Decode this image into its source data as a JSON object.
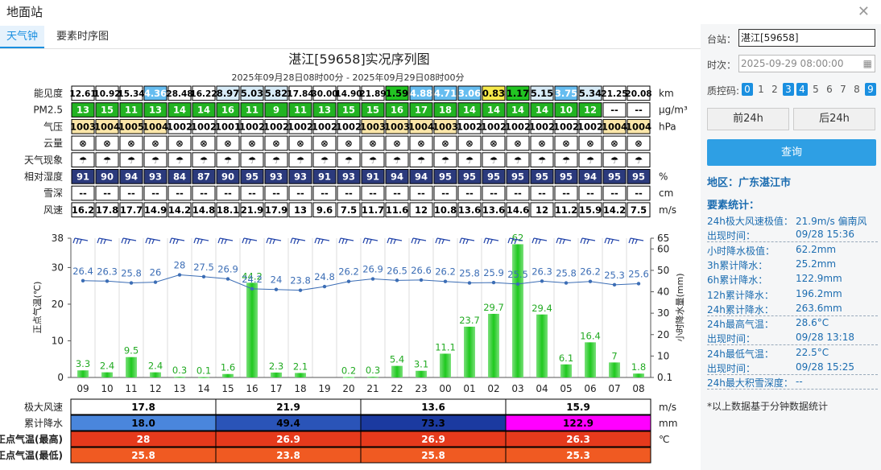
{
  "window": {
    "title": "地面站"
  },
  "tabs": [
    {
      "label": "天气钟"
    },
    {
      "label": "要素时序图"
    }
  ],
  "chart_data": {
    "type": "bar",
    "title": "湛江[59658]实况序列图",
    "subtitle": "2025年09月28日08时00分 - 2025年09月29日08时00分",
    "hours": [
      "09",
      "10",
      "11",
      "12",
      "13",
      "14",
      "15",
      "16",
      "17",
      "18",
      "19",
      "20",
      "21",
      "22",
      "23",
      "00",
      "01",
      "02",
      "03",
      "04",
      "05",
      "06",
      "07",
      "08"
    ],
    "table": {
      "rows": [
        {
          "label": "能见度",
          "unit": "km",
          "values": [
            "12.61",
            "10.92",
            "15.34",
            "4.36",
            "28.48",
            "16.22",
            "8.97",
            "5.03",
            "5.82",
            "17.84",
            "30.00",
            "14.90",
            "21.89",
            "1.59",
            "4.88",
            "4.71",
            "3.06",
            "0.83",
            "1.17",
            "5.15",
            "3.75",
            "5.34",
            "21.25",
            "20.08"
          ],
          "colors": [
            "#ffffff",
            "#ffffff",
            "#ffffff",
            "#66bdf0",
            "#ffffff",
            "#ffffff",
            "#d8ecf8",
            "#d8ecf8",
            "#d8ecf8",
            "#ffffff",
            "#ffffff",
            "#ffffff",
            "#ffffff",
            "#22c422",
            "#66bdf0",
            "#66bdf0",
            "#66bdf0",
            "#f6e94a",
            "#22c422",
            "#d8ecf8",
            "#66bdf0",
            "#d8ecf8",
            "#ffffff",
            "#ffffff"
          ]
        },
        {
          "label": "PM2.5",
          "unit": "μg/m³",
          "values": [
            "13",
            "15",
            "11",
            "13",
            "14",
            "14",
            "16",
            "11",
            "9",
            "11",
            "13",
            "15",
            "15",
            "16",
            "17",
            "18",
            "14",
            "14",
            "14",
            "14",
            "10",
            "12",
            "--",
            "--"
          ],
          "fill": "#22b322"
        },
        {
          "label": "气压",
          "unit": "hPa",
          "values": [
            "1003",
            "1004",
            "1005",
            "1004",
            "1002",
            "1002",
            "1001",
            "1002",
            "1002",
            "1002",
            "1002",
            "1002",
            "1003",
            "1003",
            "1004",
            "1003",
            "1002",
            "1002",
            "1002",
            "1002",
            "1002",
            "1002",
            "1004",
            "1004"
          ],
          "colors": [
            "#fbe6a8",
            "#fbe6a8",
            "#fbe6a8",
            "#fbe6a8",
            "#ffffff",
            "#ffffff",
            "#ffffff",
            "#ffffff",
            "#ffffff",
            "#ffffff",
            "#ffffff",
            "#ffffff",
            "#fbe6a8",
            "#fbe6a8",
            "#fbe6a8",
            "#fbe6a8",
            "#ffffff",
            "#ffffff",
            "#ffffff",
            "#ffffff",
            "#ffffff",
            "#ffffff",
            "#fbe6a8",
            "#fbe6a8"
          ]
        },
        {
          "label": "云量",
          "unit": "",
          "values": [
            "⊗",
            "⊗",
            "⊗",
            "⊗",
            "⊗",
            "⊗",
            "⊗",
            "⊗",
            "⊗",
            "⊗",
            "⊗",
            "⊗",
            "⊗",
            "⊗",
            "⊗",
            "⊗",
            "⊗",
            "⊗",
            "⊗",
            "⊗",
            "⊗",
            "⊗",
            "⊗",
            "⊗"
          ]
        },
        {
          "label": "天气现象",
          "unit": "",
          "values": [
            "☂",
            "☂",
            "☂",
            "☂",
            "☂",
            "☂",
            "☂",
            "☂",
            "☂",
            "☂",
            "☂",
            "☂",
            "☂",
            "☂",
            "☂",
            "☂",
            "☂",
            "☂",
            "☂",
            "☂",
            "☂",
            "☂",
            "☂",
            "☂"
          ]
        },
        {
          "label": "相对湿度",
          "unit": "%",
          "values": [
            "91",
            "90",
            "94",
            "93",
            "84",
            "87",
            "90",
            "95",
            "93",
            "93",
            "91",
            "93",
            "91",
            "94",
            "94",
            "95",
            "95",
            "95",
            "95",
            "95",
            "95",
            "94",
            "95",
            "95"
          ],
          "fill": "#2b3a7c"
        },
        {
          "label": "雪深",
          "unit": "cm",
          "values": [
            "--",
            "--",
            "--",
            "--",
            "--",
            "--",
            "--",
            "--",
            "--",
            "--",
            "--",
            "--",
            "--",
            "--",
            "--",
            "--",
            "--",
            "--",
            "--",
            "--",
            "--",
            "--",
            "--",
            "--"
          ]
        },
        {
          "label": "风速",
          "unit": "m/s",
          "values": [
            "16.2",
            "17.8",
            "17.7",
            "14.9",
            "14.2",
            "14.8",
            "18.1",
            "21.9",
            "17.9",
            "13",
            "9.6",
            "7.5",
            "11.7",
            "11.6",
            "12",
            "10.8",
            "13.6",
            "13.6",
            "14.6",
            "12",
            "11.2",
            "15.9",
            "14.2",
            "7.5"
          ]
        }
      ]
    },
    "temperature": [
      26.4,
      26.3,
      25.8,
      26,
      28,
      27.5,
      26.9,
      24.2,
      24,
      23.8,
      24.8,
      26.2,
      26.9,
      26.5,
      26.6,
      26.2,
      25.8,
      25.9,
      25.5,
      26.3,
      25.8,
      26.2,
      25.3,
      25.6
    ],
    "precip": [
      3.3,
      2.4,
      9.5,
      2.4,
      0.3,
      0.1,
      1.6,
      44.2,
      2.3,
      2.1,
      0,
      0.2,
      0.3,
      5.4,
      3.1,
      11.1,
      23.7,
      29.7,
      62.2,
      29.4,
      6.1,
      16.4,
      7,
      1.8
    ],
    "precip_labels": [
      "3.3",
      "2.4",
      "9.5",
      "2.4",
      "0.3",
      "0.1",
      "1.6",
      "44.2",
      "2.3",
      "2.1",
      "",
      "0.2",
      "0.3",
      "5.4",
      "3.1",
      "11.1",
      "23.7",
      "29.7",
      "62",
      "29.4",
      "6.1",
      "16.4",
      "7",
      "1.8"
    ],
    "ylabel_left": "正点气温(℃)",
    "ylabel_right": "小时降水量(mm)",
    "yleft_ticks": [
      "0",
      "10",
      "20",
      "30",
      "38"
    ],
    "yright_ticks": [
      "0.1",
      "10",
      "20",
      "30",
      "40",
      "50",
      "60",
      "65"
    ],
    "ylim_left": [
      0,
      38
    ],
    "ylim_right": [
      0,
      65
    ],
    "summary": [
      {
        "label": "极大风速",
        "unit": "m/s",
        "values": [
          "17.8",
          "21.9",
          "13.6",
          "15.9"
        ],
        "colors": [
          "#ffffff",
          "#ffffff",
          "#ffffff",
          "#ffffff"
        ],
        "text": "#000"
      },
      {
        "label": "累计降水",
        "unit": "mm",
        "values": [
          "18.0",
          "49.4",
          "73.3",
          "122.9"
        ],
        "colors": [
          "#4a86dc",
          "#2a54b8",
          "#1b3aa0",
          "#ff00ff"
        ],
        "text": "#000"
      },
      {
        "label": "正点气温(最高)",
        "unit": "℃",
        "values": [
          "28",
          "26.9",
          "26.9",
          "26.3"
        ],
        "colors": [
          "#e63a1c",
          "#e63a1c",
          "#e63a1c",
          "#e63a1c"
        ],
        "text": "#fff"
      },
      {
        "label": "正点气温(最低)",
        "unit": "",
        "values": [
          "25.8",
          "23.8",
          "25.8",
          "25.3"
        ],
        "colors": [
          "#f05a22",
          "#f05a22",
          "#f05a22",
          "#f05a22"
        ],
        "text": "#fff"
      }
    ],
    "colors": {
      "temp_line": "#3b6db5",
      "bar": "#22c422",
      "bar_label": "#22aa22"
    }
  },
  "sidebar": {
    "station_label": "台站：",
    "station_value": "湛江[59658]",
    "time_label": "时次：",
    "time_value": "2025-09-29 08:00:00",
    "qc_label": "质控码:",
    "qc": [
      {
        "v": "0",
        "on": true
      },
      {
        "v": "1",
        "on": false
      },
      {
        "v": "2",
        "on": false
      },
      {
        "v": "3",
        "on": true
      },
      {
        "v": "4",
        "on": true
      },
      {
        "v": "5",
        "on": false
      },
      {
        "v": "6",
        "on": false
      },
      {
        "v": "7",
        "on": false
      },
      {
        "v": "8",
        "on": false
      },
      {
        "v": "9",
        "on": true
      }
    ],
    "prev_btn": "前24h",
    "next_btn": "后24h",
    "query_btn": "查询",
    "region": "地区：广东湛江市",
    "stats_title": "要素统计：",
    "stats": [
      {
        "k": "24h极大风速极值：",
        "v": "21.9m/s 偏南风",
        "sep": false
      },
      {
        "k": "出现时间：",
        "v": "09/28 15:36",
        "sep": true
      },
      {
        "k": "小时降水极值：",
        "v": "62.2mm",
        "sep": false
      },
      {
        "k": "3h累计降水：",
        "v": "25.2mm",
        "sep": false
      },
      {
        "k": "6h累计降水：",
        "v": "122.9mm",
        "sep": false
      },
      {
        "k": "12h累计降水：",
        "v": "196.2mm",
        "sep": false
      },
      {
        "k": "24h累计降水：",
        "v": "263.6mm",
        "sep": true
      },
      {
        "k": "24h最高气温：",
        "v": "28.6°C",
        "sep": false
      },
      {
        "k": "出现时间：",
        "v": "09/28 13:18",
        "sep": true
      },
      {
        "k": "24h最低气温：",
        "v": "22.5°C",
        "sep": false
      },
      {
        "k": "出现时间：",
        "v": "09/28 15:25",
        "sep": true
      },
      {
        "k": "24h最大积雪深度：",
        "v": "--",
        "sep": true
      }
    ],
    "footnote": "*以上数据基于分钟数据统计"
  }
}
